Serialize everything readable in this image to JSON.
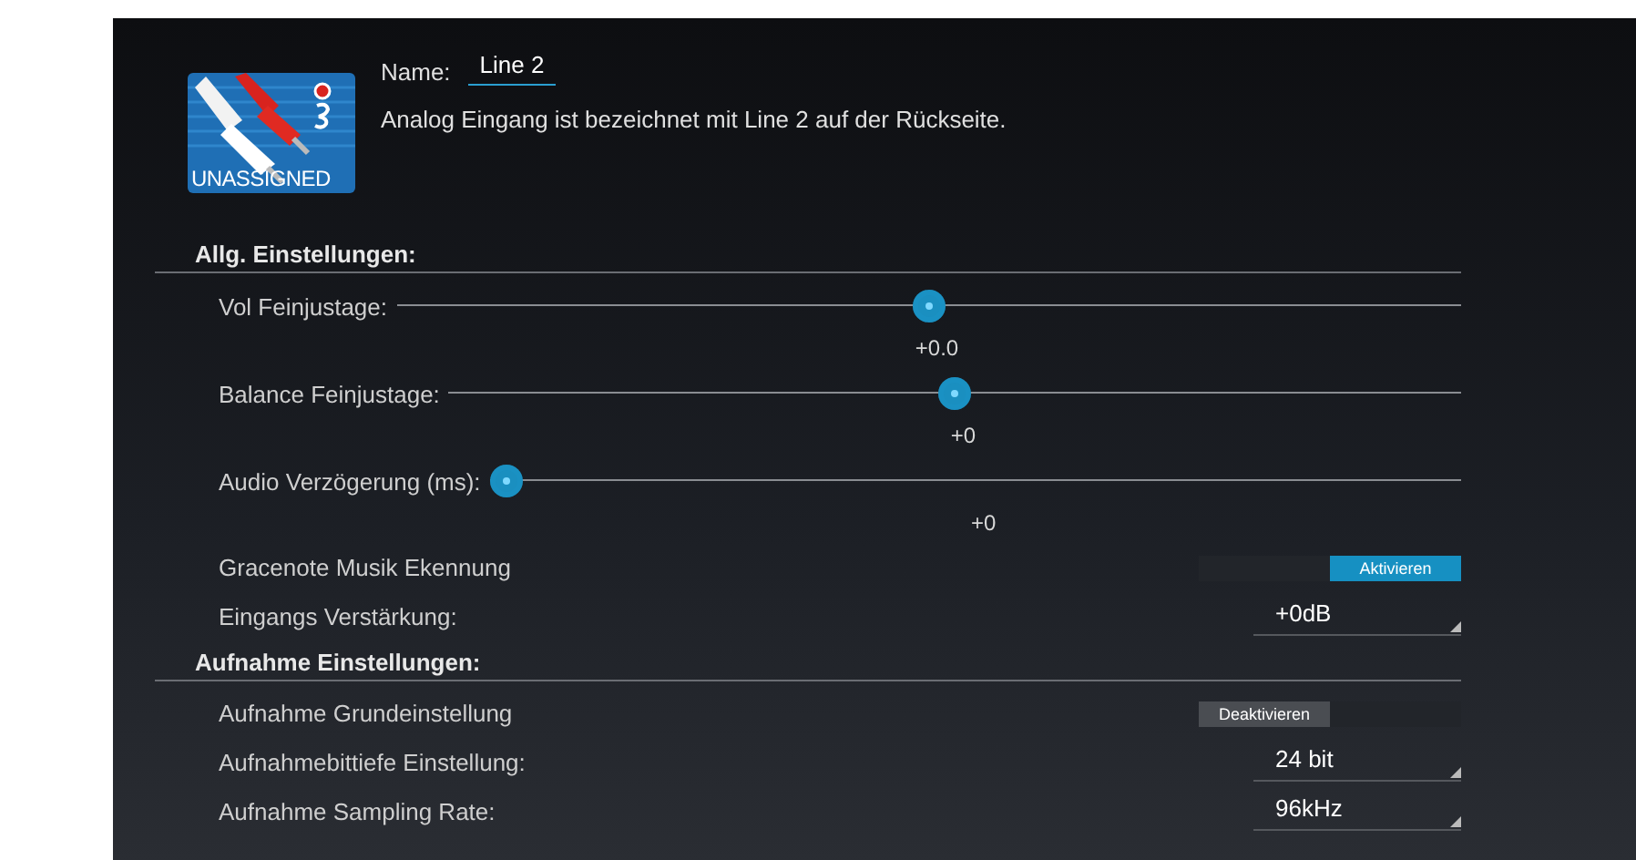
{
  "input": {
    "badge": "UNASSIGNED",
    "name_label": "Name:",
    "name_value": "Line 2",
    "description": "Analog Eingang ist bezeichnet mit Line 2 auf der Rückseite."
  },
  "sections": [
    {
      "title": "Allg. Einstellungen:",
      "rows": [
        {
          "kind": "slider",
          "label": "Vol Feinjustage:",
          "level": 0.5,
          "reading": "+0.0"
        },
        {
          "kind": "slider",
          "label": "Balance Feinjustage:",
          "level": 0.5,
          "reading": "+0"
        },
        {
          "kind": "slider",
          "label": "Audio Verzögerung (ms):",
          "level": 0,
          "reading": "+0"
        },
        {
          "kind": "toggle",
          "label": "Gracenote Musik Ekennung",
          "on": true,
          "button": "Aktivieren"
        },
        {
          "kind": "dropdown",
          "label": "Eingangs Verstärkung:",
          "value": "+0dB"
        }
      ]
    },
    {
      "title": "Aufnahme Einstellungen:",
      "rows": [
        {
          "kind": "toggle",
          "label": "Aufnahme Grundeinstellung",
          "on": false,
          "button": "Deaktivieren"
        },
        {
          "kind": "dropdown",
          "label": "Aufnahmebittiefe Einstellung:",
          "value": "24 bit"
        },
        {
          "kind": "dropdown",
          "label": "Aufnahme Sampling Rate:",
          "value": "96kHz"
        }
      ]
    }
  ]
}
